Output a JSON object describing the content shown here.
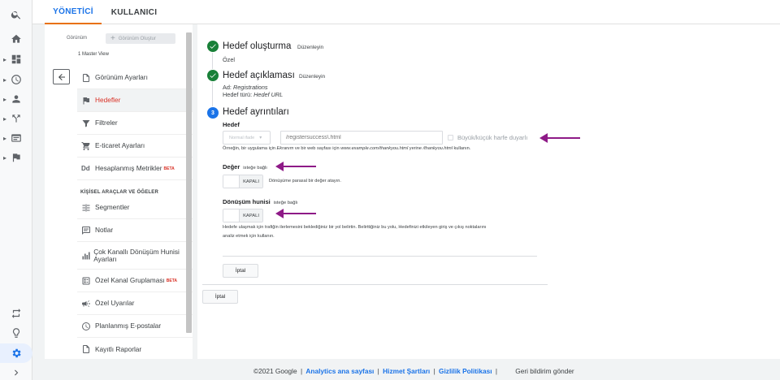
{
  "tabs": [
    {
      "label": "YÖNETİCİ",
      "active": true
    },
    {
      "label": "KULLANICI",
      "active": false
    }
  ],
  "rail": {
    "icons": [
      "search-icon",
      "home-icon",
      "dashboard-icon",
      "clock-icon",
      "person-icon",
      "acquisition-icon",
      "behavior-icon",
      "flag-icon",
      "share-icon",
      "lightbulb-icon",
      "gear-icon",
      "chevron-right-icon"
    ]
  },
  "view": {
    "label": "Görünüm",
    "create_button": "Görünüm Oluştur",
    "selected": "1 Master View"
  },
  "menu": {
    "items": [
      {
        "label": "Görünüm Ayarları",
        "icon": "document-icon"
      },
      {
        "label": "Hedefler",
        "icon": "flag-icon",
        "active": true
      },
      {
        "label": "Filtreler",
        "icon": "filter-icon"
      },
      {
        "label": "E-ticaret Ayarları",
        "icon": "cart-icon"
      },
      {
        "label": "Hesaplanmış Metrikler",
        "icon": "calculated-metric-icon",
        "badge": "BETA",
        "icon_text": "Dd"
      }
    ],
    "section_title": "KİŞİSEL ARAÇLAR VE ÖĞELER",
    "tools": [
      {
        "label": "Segmentler",
        "icon": "segments-icon"
      },
      {
        "label": "Notlar",
        "icon": "notes-icon"
      },
      {
        "label": "Çok Kanallı Dönüşüm Hunisi Ayarları",
        "icon": "bar-chart-icon"
      },
      {
        "label": "Özel Kanal Gruplaması",
        "icon": "channel-group-icon",
        "badge": "BETA"
      },
      {
        "label": "Özel Uyarılar",
        "icon": "megaphone-icon"
      },
      {
        "label": "Planlanmış E-postalar",
        "icon": "clock-icon"
      },
      {
        "label": "Kayıtlı Raporlar",
        "icon": "report-icon"
      }
    ]
  },
  "goal": {
    "step1": {
      "title": "Hedef oluşturma",
      "edit": "Düzenleyin",
      "value": "Özel"
    },
    "step2": {
      "title": "Hedef açıklaması",
      "edit": "Düzenleyin",
      "name_prefix": "Ad:",
      "name_value": "Registrations",
      "type_prefix": "Hedef türü:",
      "type_value": "Hedef URL"
    },
    "step3": {
      "number": "3",
      "title": "Hedef ayrıntıları",
      "destination_label": "Hedef",
      "match_type": "Normal ifade",
      "url_placeholder": "/registersuccess\\.html",
      "case_sensitive_label": "Büyük/küçük harfe duyarlı",
      "example_a": "Örneğin, bir uygulama için ",
      "example_b": "Ekranım",
      "example_c": " ve bir web sayfası için ",
      "example_d": "www.example.com/thankyou.html",
      "example_e": " yerine ",
      "example_f": "/thankyou.html",
      "example_g": " kullanın.",
      "value_label": "Değer",
      "optional": "isteğe bağlı",
      "toggle_off": "KAPALI",
      "value_hint": "Dönüşüme parasal bir değer atayın.",
      "funnel_label": "Dönüşüm hunisi",
      "funnel_hint_1": "Hedefe ulaşmak için trafiğin ilerlemesini beklediğiniz bir yol belirtin. Belirttiğiniz bu yolu, Hedefinizi etkileyen giriş ve çıkış noktalarını",
      "funnel_hint_2": "analiz etmek için kullanın.",
      "cancel_inner": "İptal"
    },
    "cancel_outer": "İptal"
  },
  "footer": {
    "copyright": "©2021 Google",
    "link1": "Analytics ana sayfası",
    "link2": "Hizmet Şartları",
    "link3": "Gizlilik Politikası",
    "sep": "|",
    "feedback": "Geri bildirim gönder"
  },
  "colors": {
    "accent": "#1a73e8",
    "tab_underline": "#e8710a",
    "success": "#188038",
    "annotation_arrow": "#8e1a87",
    "active_menu": "#d93025"
  }
}
